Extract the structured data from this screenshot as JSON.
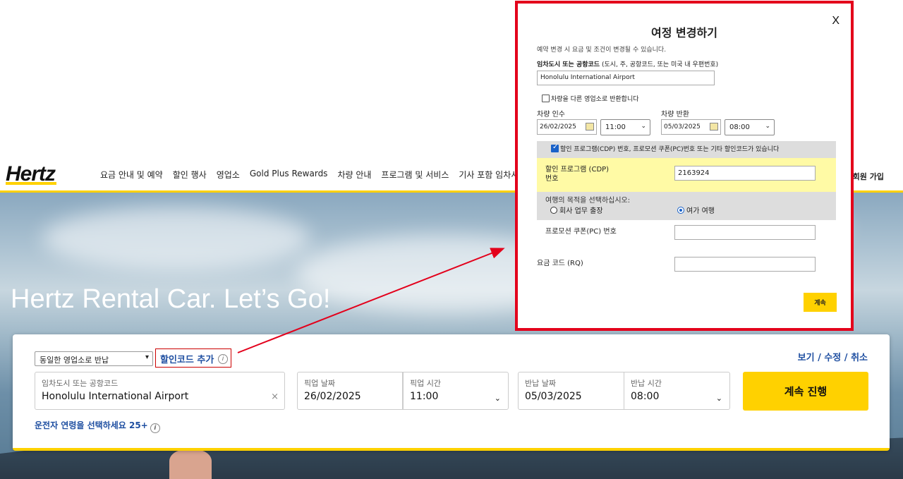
{
  "header": {
    "logo": "Hertz",
    "nav": [
      "요금 안내 및 예약",
      "할인 행사",
      "영업소",
      "Gold Plus Rewards",
      "차량 안내",
      "프로그램 및 서비스",
      "기사 포함 임차서비스"
    ],
    "login_label": "/회원 가입"
  },
  "hero": {
    "title": "Hertz Rental Car. Let’s Go!"
  },
  "booking": {
    "return_select": "동일한 영업소로 반납",
    "discount_link": "할인코드 추가",
    "manage_link": "보기 / 수정 / 취소",
    "location_label": "임차도시 또는 공항코드",
    "location_value": "Honolulu International Airport",
    "clear_symbol": "×",
    "pickup_date_label": "픽업 날짜",
    "pickup_date": "26/02/2025",
    "pickup_time_label": "픽업 시간",
    "pickup_time": "11:00",
    "return_date_label": "반납 날짜",
    "return_date": "05/03/2025",
    "return_time_label": "반납 시간",
    "return_time": "08:00",
    "continue_label": "계속 진행",
    "age_link": "운전자 연령을 선택하세요 25+"
  },
  "modal": {
    "close": "X",
    "title": "여정 변경하기",
    "note": "예약 변경 시 요금 및 조건이 변경될 수 있습니다.",
    "location_label_bold": "임차도시 또는 공항코드",
    "location_label_hint": " (도시, 주, 공항코드, 또는 미국 내 우편번호)",
    "location_value": "Honolulu International Airport",
    "return_other_label": "차량을 다른 영업소로 반환합니다",
    "pickup_label": "차량 인수",
    "pickup_date": "26/02/2025",
    "pickup_time": "11:00",
    "return_label": "차량 반환",
    "return_date": "05/03/2025",
    "return_time": "08:00",
    "cdp_check_label": "할인 프로그램(CDP) 번호, 프로모션 쿠폰(PC)번호 또는 기타 할인코드가 있습니다",
    "cdp_label": "할인 프로그램 (CDP) 번호",
    "cdp_value": "2163924",
    "purpose_question": "여행의 목적을 선택하십시오:",
    "purpose_business": "회사 업무 출장",
    "purpose_leisure": "여가 여행",
    "pc_label": "프로모션 쿠폰(PC) 번호",
    "rq_label": "요금 코드 (RQ)",
    "continue_label": "계속"
  },
  "colors": {
    "brand_yellow": "#ffd100",
    "link_blue": "#1f4fa1",
    "highlight_red": "#e3001b"
  }
}
